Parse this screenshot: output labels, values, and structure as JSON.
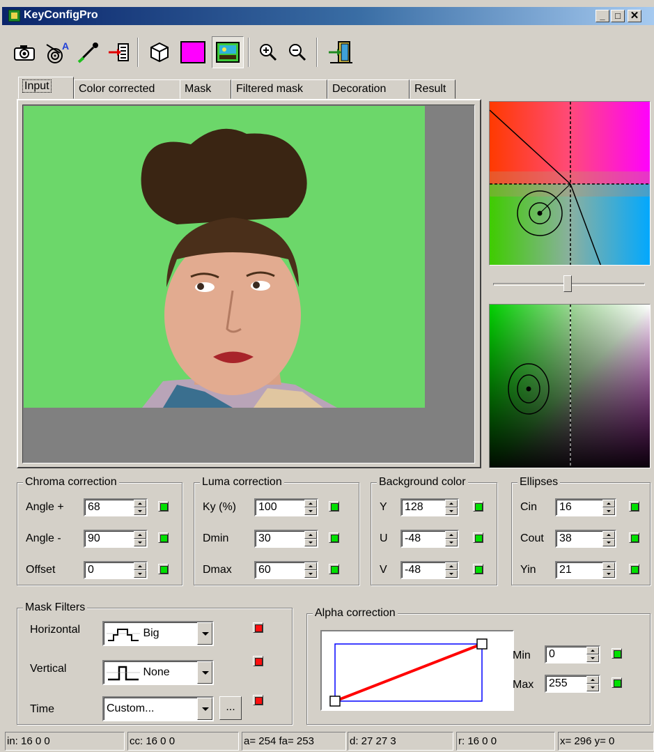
{
  "window": {
    "title": "KeyConfigPro"
  },
  "toolbar": {
    "buttons": [
      {
        "name": "camera-icon"
      },
      {
        "name": "color-wheel-text-icon"
      },
      {
        "name": "eyedropper-icon"
      },
      {
        "name": "import-filter-icon"
      },
      {
        "name": "cube-icon"
      },
      {
        "name": "magenta-swatch-icon",
        "color": "#ff00ff"
      },
      {
        "name": "image-preview-icon"
      },
      {
        "name": "zoom-in-icon"
      },
      {
        "name": "zoom-out-icon"
      },
      {
        "name": "exit-door-icon"
      }
    ]
  },
  "tabs": [
    "Input",
    "Color corrected",
    "Mask",
    "Filtered mask",
    "Decoration",
    "Result"
  ],
  "active_tab": "Input",
  "chroma": {
    "title": "Chroma correction",
    "rows": [
      {
        "label": "Angle +",
        "value": "68"
      },
      {
        "label": "Angle -",
        "value": "90"
      },
      {
        "label": "Offset",
        "value": "0"
      }
    ]
  },
  "luma": {
    "title": "Luma correction",
    "rows": [
      {
        "label": "Ky (%)",
        "value": "100"
      },
      {
        "label": "Dmin",
        "value": "30"
      },
      {
        "label": "Dmax",
        "value": "60"
      }
    ]
  },
  "background": {
    "title": "Background color",
    "rows": [
      {
        "label": "Y",
        "value": "128"
      },
      {
        "label": "U",
        "value": "-48"
      },
      {
        "label": "V",
        "value": "-48"
      }
    ]
  },
  "ellipses": {
    "title": "Ellipses",
    "rows": [
      {
        "label": "Cin",
        "value": "16"
      },
      {
        "label": "Cout",
        "value": "38"
      },
      {
        "label": "Yin",
        "value": "21"
      }
    ]
  },
  "mask_filters": {
    "title": "Mask Filters",
    "rows": [
      {
        "label": "Horizontal",
        "value": "Big"
      },
      {
        "label": "Vertical",
        "value": "None"
      },
      {
        "label": "Time",
        "value": "Custom..."
      }
    ],
    "ellipsis_button": "..."
  },
  "alpha": {
    "title": "Alpha correction",
    "min_label": "Min",
    "min_value": "0",
    "max_label": "Max",
    "max_value": "255"
  },
  "status": {
    "in": "in: 16  0  0",
    "cc": "cc: 16  0  0",
    "a": "a= 254 fa= 253",
    "d": "d: 27  27  3",
    "r": "r: 16  0  0",
    "xy": "x= 296 y=  0"
  },
  "colors": {
    "chroma_green": "#6cd76a",
    "led_on": "#00e000",
    "led_off": "#ff1010",
    "magenta": "#ff00ff",
    "curve": "#ff0000",
    "curve_box": "#0000ff"
  }
}
